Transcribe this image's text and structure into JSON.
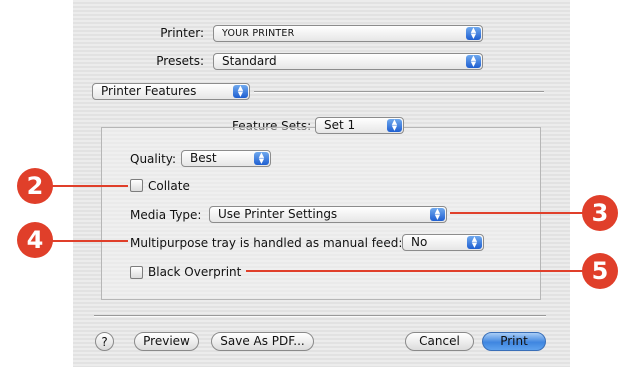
{
  "header": {
    "printer_label": "Printer:",
    "printer_value": "YOUR PRINTER",
    "presets_label": "Presets:",
    "presets_value": "Standard",
    "section_value": "Printer Features"
  },
  "panel": {
    "feature_sets_label": "Feature Sets:",
    "feature_sets_value": "Set 1",
    "quality_label": "Quality:",
    "quality_value": "Best",
    "collate_label": "Collate",
    "collate_checked": false,
    "media_type_label": "Media Type:",
    "media_type_value": "Use Printer Settings",
    "multipurpose_label": "Multipurpose tray is handled as manual feed:",
    "multipurpose_value": "No",
    "black_overprint_label": "Black Overprint",
    "black_overprint_checked": false
  },
  "footer": {
    "help_label": "?",
    "preview_label": "Preview",
    "save_pdf_label": "Save As PDF...",
    "cancel_label": "Cancel",
    "print_label": "Print"
  },
  "callouts": {
    "c2": "2",
    "c3": "3",
    "c4": "4",
    "c5": "5",
    "color": "#e03f2a"
  },
  "icons": {
    "popup_arrows": "up-down-arrows-icon"
  }
}
